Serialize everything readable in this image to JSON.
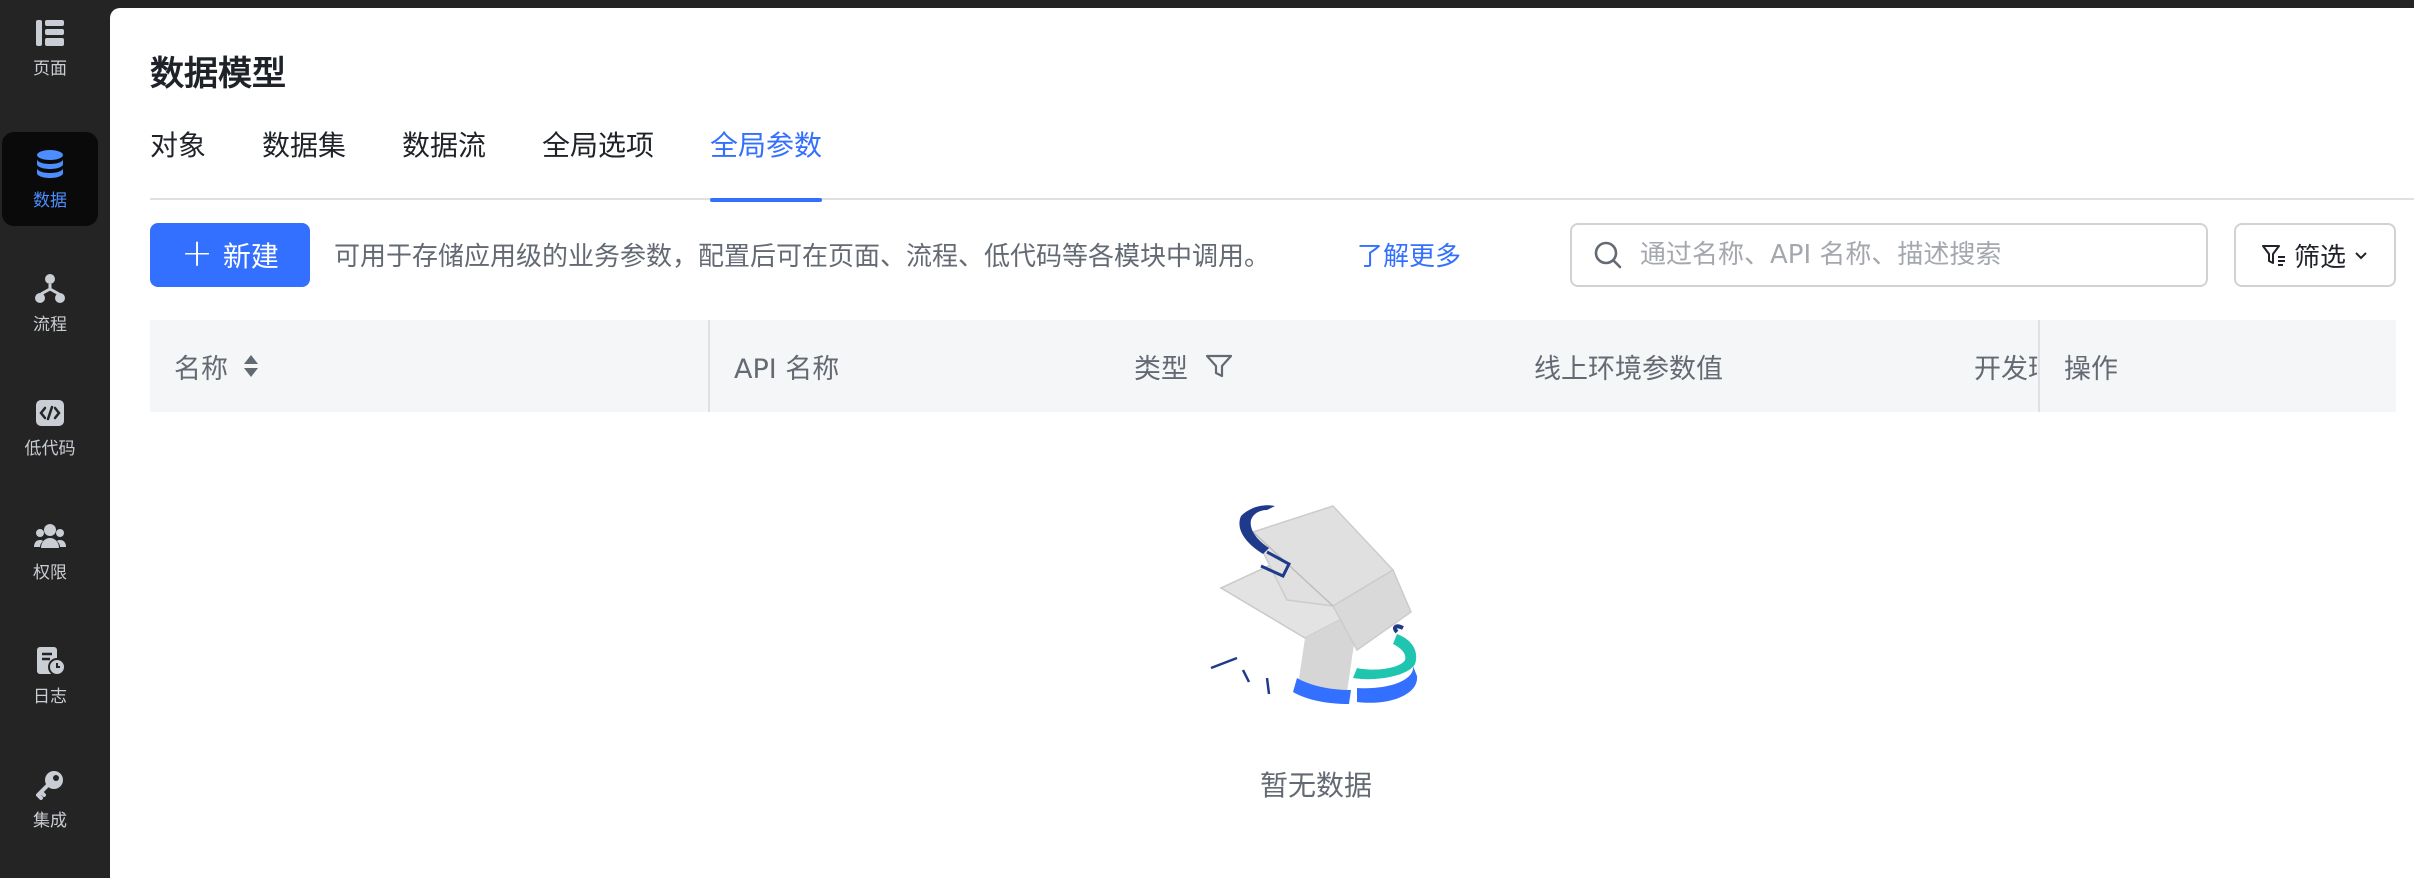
{
  "sidebar": {
    "items": [
      {
        "label": "页面",
        "icon": "page-layout-icon",
        "active": false
      },
      {
        "label": "数据",
        "icon": "database-icon",
        "active": true
      },
      {
        "label": "流程",
        "icon": "flow-icon",
        "active": false
      },
      {
        "label": "低代码",
        "icon": "code-icon",
        "active": false
      },
      {
        "label": "权限",
        "icon": "users-icon",
        "active": false
      },
      {
        "label": "日志",
        "icon": "log-clock-icon",
        "active": false
      },
      {
        "label": "集成",
        "icon": "key-icon",
        "active": false
      }
    ]
  },
  "header": {
    "title": "数据模型",
    "tabs": [
      {
        "label": "对象",
        "active": false
      },
      {
        "label": "数据集",
        "active": false
      },
      {
        "label": "数据流",
        "active": false
      },
      {
        "label": "全局选项",
        "active": false
      },
      {
        "label": "全局参数",
        "active": true
      }
    ]
  },
  "toolbar": {
    "new_label": "新建",
    "description": "可用于存储应用级的业务参数，配置后可在页面、流程、低代码等各模块中调用。",
    "learn_more": "了解更多",
    "search_placeholder": "通过名称、API 名称、描述搜索",
    "filter_label": "筛选"
  },
  "table": {
    "columns": [
      "名称",
      "API 名称",
      "类型",
      "线上环境参数值",
      "开发环",
      "操作"
    ]
  },
  "empty": {
    "text": "暂无数据"
  },
  "colors": {
    "accent": "#3370ff",
    "sidebar_bg": "#242424",
    "teal": "#20c5b0",
    "navy": "#1f3a8a"
  }
}
